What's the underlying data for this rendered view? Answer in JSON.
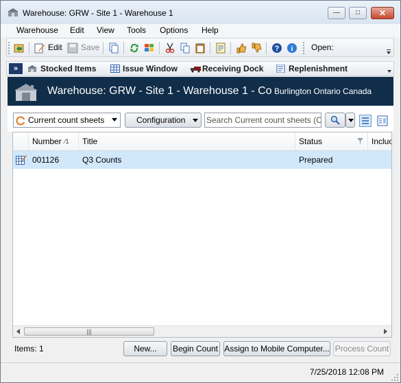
{
  "window": {
    "title": "Warehouse: GRW - Site 1 - Warehouse 1"
  },
  "menu": [
    "Warehouse",
    "Edit",
    "View",
    "Tools",
    "Options",
    "Help"
  ],
  "toolbar": {
    "edit_label": "Edit",
    "save_label": "Save",
    "open_label": "Open:"
  },
  "nav": {
    "items": [
      "Stocked Items",
      "Issue Window",
      "Receiving Dock",
      "Replenishment"
    ]
  },
  "header": {
    "title": "Warehouse: GRW - Site 1 - Warehouse 1 - Co",
    "location": "Burlington Ontario Canada"
  },
  "filter": {
    "view_select": "Current count sheets",
    "configuration_label": "Configuration",
    "search_placeholder": "Search Current count sheets (Ctrl+"
  },
  "grid": {
    "columns": [
      "Number",
      "Title",
      "Status",
      "Incluc"
    ],
    "sort_indicator": "1",
    "rows": [
      {
        "number": "001126",
        "title": "Q3 Counts",
        "status": "Prepared"
      }
    ]
  },
  "footer": {
    "items_label": "Items: 1",
    "buttons": [
      "New...",
      "Begin Count",
      "Assign to Mobile Computer...",
      "Process Count"
    ]
  },
  "status": {
    "datetime": "7/25/2018 12:08 PM"
  },
  "colors": {
    "header_bg": "#102d49",
    "selected_row": "#d1e8fb"
  }
}
